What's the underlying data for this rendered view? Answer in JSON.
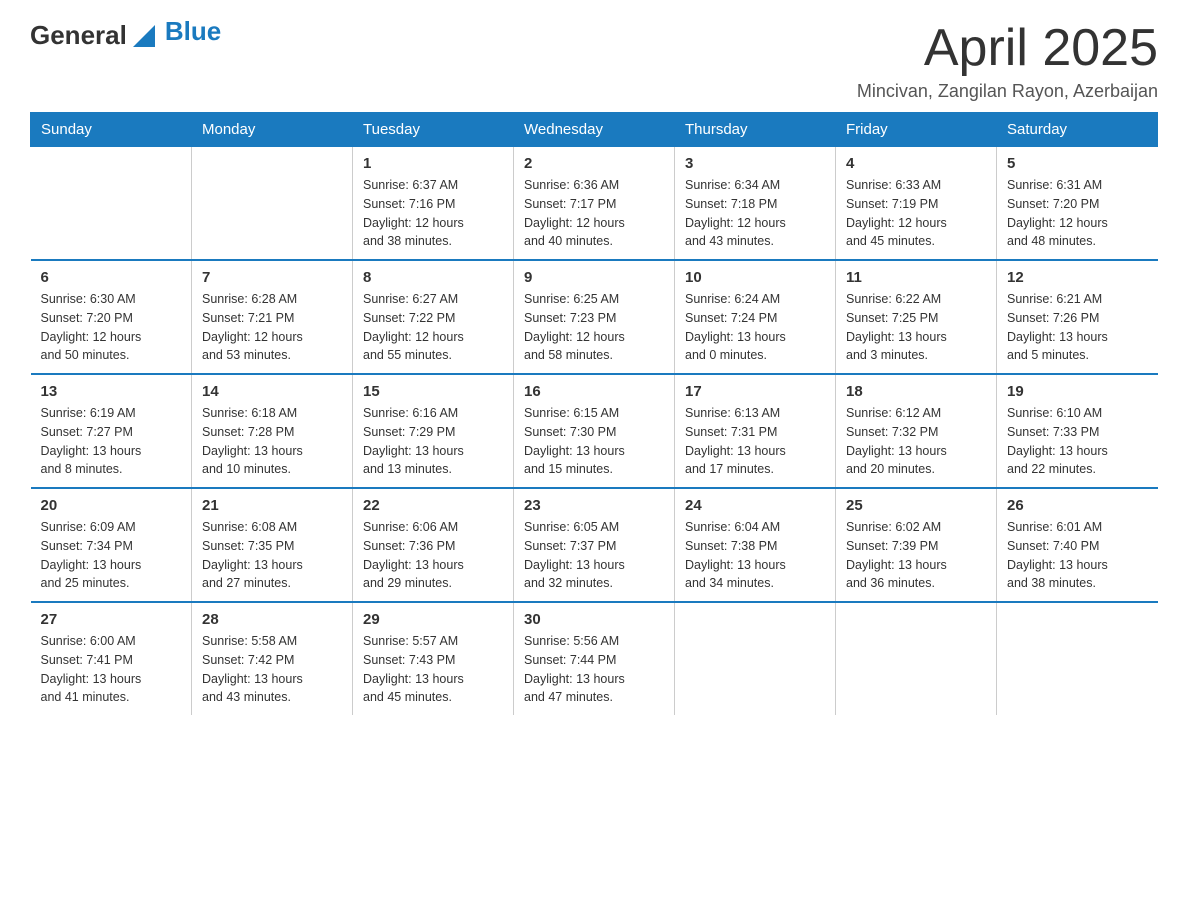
{
  "logo": {
    "text_general": "General",
    "text_blue": "Blue",
    "arrow": "▶"
  },
  "title": "April 2025",
  "subtitle": "Mincivan, Zangilan Rayon, Azerbaijan",
  "headers": [
    "Sunday",
    "Monday",
    "Tuesday",
    "Wednesday",
    "Thursday",
    "Friday",
    "Saturday"
  ],
  "weeks": [
    [
      {
        "num": "",
        "info": ""
      },
      {
        "num": "",
        "info": ""
      },
      {
        "num": "1",
        "info": "Sunrise: 6:37 AM\nSunset: 7:16 PM\nDaylight: 12 hours\nand 38 minutes."
      },
      {
        "num": "2",
        "info": "Sunrise: 6:36 AM\nSunset: 7:17 PM\nDaylight: 12 hours\nand 40 minutes."
      },
      {
        "num": "3",
        "info": "Sunrise: 6:34 AM\nSunset: 7:18 PM\nDaylight: 12 hours\nand 43 minutes."
      },
      {
        "num": "4",
        "info": "Sunrise: 6:33 AM\nSunset: 7:19 PM\nDaylight: 12 hours\nand 45 minutes."
      },
      {
        "num": "5",
        "info": "Sunrise: 6:31 AM\nSunset: 7:20 PM\nDaylight: 12 hours\nand 48 minutes."
      }
    ],
    [
      {
        "num": "6",
        "info": "Sunrise: 6:30 AM\nSunset: 7:20 PM\nDaylight: 12 hours\nand 50 minutes."
      },
      {
        "num": "7",
        "info": "Sunrise: 6:28 AM\nSunset: 7:21 PM\nDaylight: 12 hours\nand 53 minutes."
      },
      {
        "num": "8",
        "info": "Sunrise: 6:27 AM\nSunset: 7:22 PM\nDaylight: 12 hours\nand 55 minutes."
      },
      {
        "num": "9",
        "info": "Sunrise: 6:25 AM\nSunset: 7:23 PM\nDaylight: 12 hours\nand 58 minutes."
      },
      {
        "num": "10",
        "info": "Sunrise: 6:24 AM\nSunset: 7:24 PM\nDaylight: 13 hours\nand 0 minutes."
      },
      {
        "num": "11",
        "info": "Sunrise: 6:22 AM\nSunset: 7:25 PM\nDaylight: 13 hours\nand 3 minutes."
      },
      {
        "num": "12",
        "info": "Sunrise: 6:21 AM\nSunset: 7:26 PM\nDaylight: 13 hours\nand 5 minutes."
      }
    ],
    [
      {
        "num": "13",
        "info": "Sunrise: 6:19 AM\nSunset: 7:27 PM\nDaylight: 13 hours\nand 8 minutes."
      },
      {
        "num": "14",
        "info": "Sunrise: 6:18 AM\nSunset: 7:28 PM\nDaylight: 13 hours\nand 10 minutes."
      },
      {
        "num": "15",
        "info": "Sunrise: 6:16 AM\nSunset: 7:29 PM\nDaylight: 13 hours\nand 13 minutes."
      },
      {
        "num": "16",
        "info": "Sunrise: 6:15 AM\nSunset: 7:30 PM\nDaylight: 13 hours\nand 15 minutes."
      },
      {
        "num": "17",
        "info": "Sunrise: 6:13 AM\nSunset: 7:31 PM\nDaylight: 13 hours\nand 17 minutes."
      },
      {
        "num": "18",
        "info": "Sunrise: 6:12 AM\nSunset: 7:32 PM\nDaylight: 13 hours\nand 20 minutes."
      },
      {
        "num": "19",
        "info": "Sunrise: 6:10 AM\nSunset: 7:33 PM\nDaylight: 13 hours\nand 22 minutes."
      }
    ],
    [
      {
        "num": "20",
        "info": "Sunrise: 6:09 AM\nSunset: 7:34 PM\nDaylight: 13 hours\nand 25 minutes."
      },
      {
        "num": "21",
        "info": "Sunrise: 6:08 AM\nSunset: 7:35 PM\nDaylight: 13 hours\nand 27 minutes."
      },
      {
        "num": "22",
        "info": "Sunrise: 6:06 AM\nSunset: 7:36 PM\nDaylight: 13 hours\nand 29 minutes."
      },
      {
        "num": "23",
        "info": "Sunrise: 6:05 AM\nSunset: 7:37 PM\nDaylight: 13 hours\nand 32 minutes."
      },
      {
        "num": "24",
        "info": "Sunrise: 6:04 AM\nSunset: 7:38 PM\nDaylight: 13 hours\nand 34 minutes."
      },
      {
        "num": "25",
        "info": "Sunrise: 6:02 AM\nSunset: 7:39 PM\nDaylight: 13 hours\nand 36 minutes."
      },
      {
        "num": "26",
        "info": "Sunrise: 6:01 AM\nSunset: 7:40 PM\nDaylight: 13 hours\nand 38 minutes."
      }
    ],
    [
      {
        "num": "27",
        "info": "Sunrise: 6:00 AM\nSunset: 7:41 PM\nDaylight: 13 hours\nand 41 minutes."
      },
      {
        "num": "28",
        "info": "Sunrise: 5:58 AM\nSunset: 7:42 PM\nDaylight: 13 hours\nand 43 minutes."
      },
      {
        "num": "29",
        "info": "Sunrise: 5:57 AM\nSunset: 7:43 PM\nDaylight: 13 hours\nand 45 minutes."
      },
      {
        "num": "30",
        "info": "Sunrise: 5:56 AM\nSunset: 7:44 PM\nDaylight: 13 hours\nand 47 minutes."
      },
      {
        "num": "",
        "info": ""
      },
      {
        "num": "",
        "info": ""
      },
      {
        "num": "",
        "info": ""
      }
    ]
  ]
}
